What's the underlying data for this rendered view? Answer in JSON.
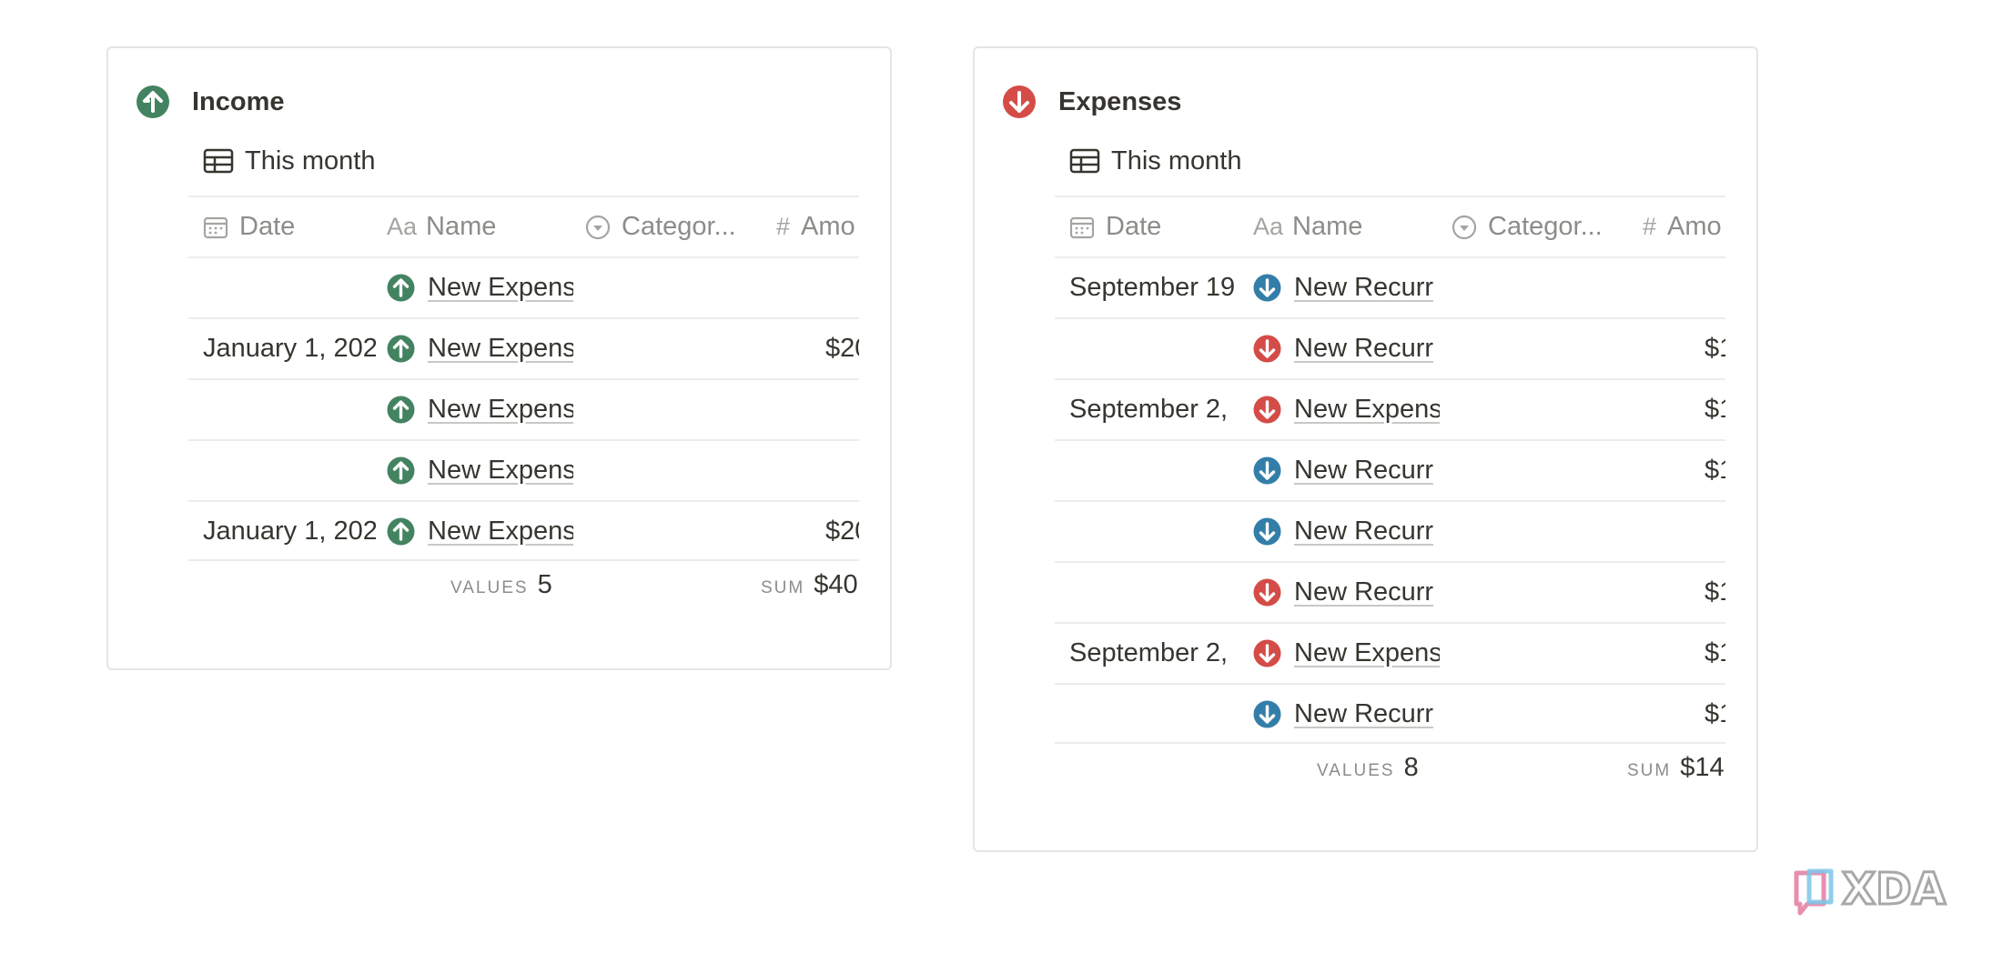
{
  "income": {
    "title": "Income",
    "view": "This month",
    "columns": {
      "date": "Date",
      "name": "Name",
      "category": "Categor...",
      "amount": "Amo",
      "name_icon": "Aa"
    },
    "rows": [
      {
        "date": "",
        "name": "New Expens",
        "amount": ""
      },
      {
        "date": "January 1, 202",
        "name": "New Expens",
        "amount": "$20"
      },
      {
        "date": "",
        "name": "New Expens",
        "amount": ""
      },
      {
        "date": "",
        "name": "New Expens",
        "amount": ""
      },
      {
        "date": "January 1, 202",
        "name": "New Expens",
        "amount": "$20"
      }
    ],
    "values_label": "VALUES",
    "values_count": "5",
    "sum_label": "SUM",
    "sum_value": "$40"
  },
  "expenses": {
    "title": "Expenses",
    "view": "This month",
    "columns": {
      "date": "Date",
      "name": "Name",
      "category": "Categor...",
      "amount": "Amo",
      "name_icon": "Aa"
    },
    "rows": [
      {
        "date": "September 19",
        "name": "New Recurr",
        "icon": "blue-down",
        "amount": ""
      },
      {
        "date": "",
        "name": "New Recurr",
        "icon": "red-down",
        "amount": "$1"
      },
      {
        "date": "September 2,",
        "name": "New Expens",
        "icon": "red-down",
        "amount": "$1"
      },
      {
        "date": "",
        "name": "New Recurr",
        "icon": "blue-down",
        "amount": "$1"
      },
      {
        "date": "",
        "name": "New Recurr",
        "icon": "blue-down",
        "amount": ""
      },
      {
        "date": "",
        "name": "New Recurr",
        "icon": "red-down",
        "amount": "$1"
      },
      {
        "date": "September 2,",
        "name": "New Expens",
        "icon": "red-down",
        "amount": "$1"
      },
      {
        "date": "",
        "name": "New Recurr",
        "icon": "blue-down",
        "amount": "$1"
      }
    ],
    "values_label": "VALUES",
    "values_count": "8",
    "sum_label": "SUM",
    "sum_value": "$14"
  },
  "watermark": "XDA",
  "colors": {
    "green": "#448361",
    "red": "#d44c47",
    "blue": "#337ea9"
  }
}
